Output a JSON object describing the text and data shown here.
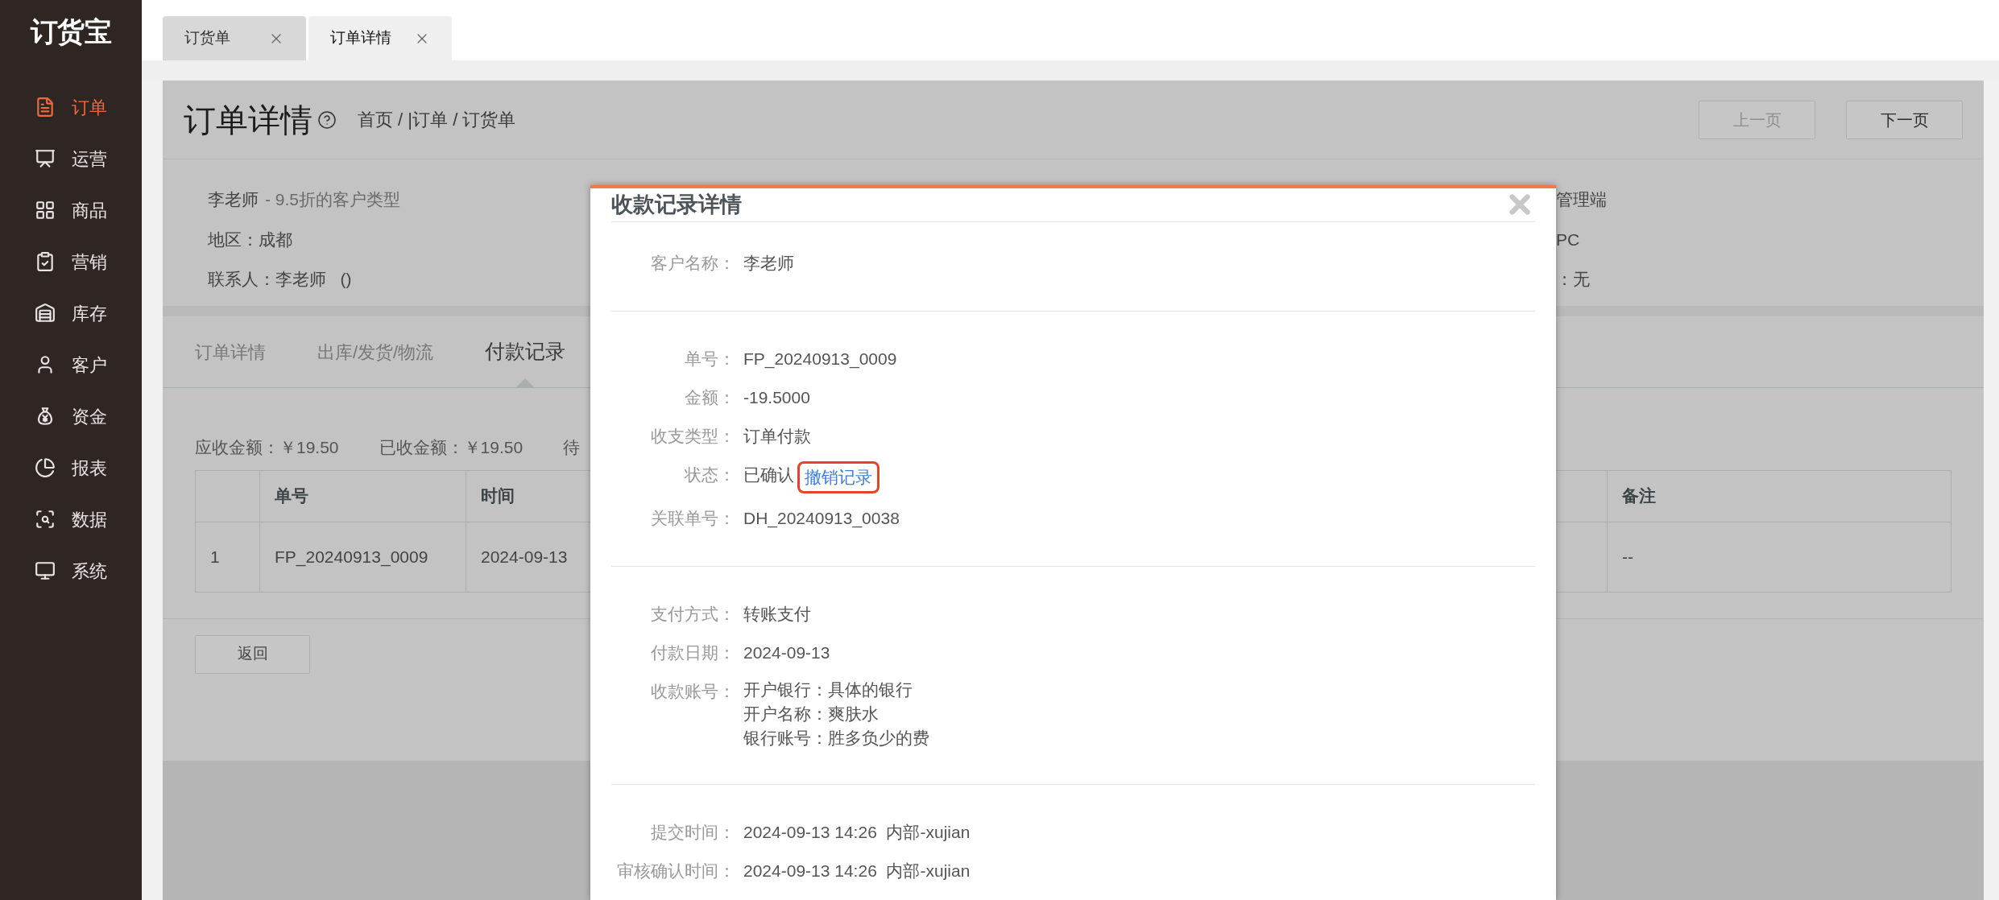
{
  "sidebar": {
    "logo": "订货宝",
    "items": [
      {
        "label": "订单",
        "selected": true
      },
      {
        "label": "运营",
        "selected": false
      },
      {
        "label": "商品",
        "selected": false
      },
      {
        "label": "营销",
        "selected": false
      },
      {
        "label": "库存",
        "selected": false
      },
      {
        "label": "客户",
        "selected": false
      },
      {
        "label": "资金",
        "selected": false
      },
      {
        "label": "报表",
        "selected": false
      },
      {
        "label": "数据",
        "selected": false
      },
      {
        "label": "系统",
        "selected": false
      }
    ]
  },
  "tabs": [
    {
      "label": "订货单",
      "selected": false
    },
    {
      "label": "订单详情",
      "selected": true
    }
  ],
  "page": {
    "title": "订单详情",
    "breadcrumb": "首页 / |订单 / 订货单",
    "buttons": [
      {
        "label": "上一页",
        "disabled": true
      },
      {
        "label": "下一页",
        "disabled": false
      }
    ]
  },
  "customer": {
    "name": "李老师",
    "type": "- 9.5折的客户类型",
    "lines": [
      "地区：成都",
      "联系人：李老师   ()"
    ]
  },
  "info_right": [
    "管理端",
    "PC",
    "：无"
  ],
  "detail_tabs": [
    {
      "label": "订单详情",
      "selected": false
    },
    {
      "label": "出库/发货/物流",
      "selected": false
    },
    {
      "label": "付款记录",
      "selected": true
    }
  ],
  "summary": [
    "应收金额：￥19.50",
    "已收金额：￥19.50",
    "待"
  ],
  "table": {
    "columns": [
      "单号",
      "时间",
      "备注"
    ],
    "rows": [
      {
        "index": "1",
        "cells": [
          "FP_20240913_0009",
          "2024-09-13",
          "--"
        ]
      }
    ]
  },
  "back_button": "返回",
  "dialog": {
    "title": "收款记录详情",
    "sections": [
      [
        {
          "label": "客户名称：",
          "value": "李老师"
        }
      ],
      [
        {
          "label": "单号：",
          "value": "FP_20240913_0009"
        },
        {
          "label": "金额：",
          "value": "-19.5000"
        },
        {
          "label": "收支类型：",
          "value": "订单付款"
        },
        {
          "label": "状态：",
          "value": "已确认",
          "action": {
            "label": "撤销记录",
            "highlighted": true
          }
        },
        {
          "label": "关联单号：",
          "value": "DH_20240913_0038"
        }
      ],
      [
        {
          "label": "支付方式：",
          "value": "转账支付"
        },
        {
          "label": "付款日期：",
          "value": "2024-09-13"
        },
        {
          "label": "收款账号：",
          "lines": [
            "开户银行：具体的银行",
            "开户名称：爽肤水",
            "银行账号：胜多负少的费"
          ]
        }
      ],
      [
        {
          "label": "提交时间：",
          "value": "2024-09-13 14:26  内部-xujian"
        },
        {
          "label": "审核确认时间：",
          "value": "2024-09-13 14:26  内部-xujian"
        }
      ]
    ]
  }
}
